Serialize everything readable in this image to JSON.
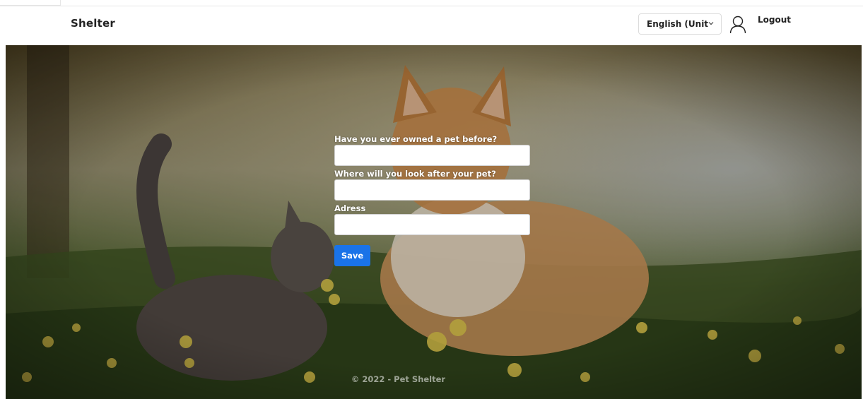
{
  "navbar": {
    "brand": "Shelter",
    "language_select": {
      "value": "English (Unit",
      "icon": "chevron-down-icon"
    },
    "user_icon": "user-icon",
    "logout_label": "Logout"
  },
  "form": {
    "fields": [
      {
        "label": "Have you ever owned a pet before?",
        "value": ""
      },
      {
        "label": "Where will you look after your pet?",
        "value": ""
      },
      {
        "label": "Adress",
        "value": ""
      }
    ],
    "save_label": "Save"
  },
  "footer": {
    "text": "© 2022 - Pet Shelter"
  },
  "colors": {
    "accent": "#1a73e8",
    "nav_bg": "#ffffff",
    "label_text": "#ffffff"
  }
}
